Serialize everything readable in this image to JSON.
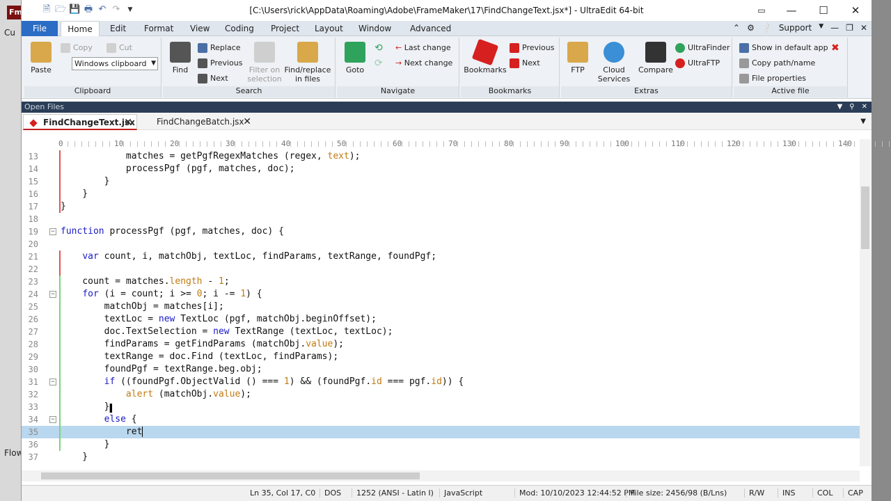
{
  "background": {
    "app_badge": "Fm",
    "left_text": "Cu",
    "flow_text": "Flow"
  },
  "window": {
    "title": "[C:\\Users\\rick\\AppData\\Roaming\\Adobe\\FrameMaker\\17\\FindChangeText.jsx*] - UltraEdit 64-bit"
  },
  "menu": {
    "file": "File",
    "tabs": [
      "Home",
      "Edit",
      "Format",
      "View",
      "Coding",
      "Project",
      "Layout",
      "Window",
      "Advanced"
    ],
    "support": "Support"
  },
  "ribbon": {
    "clipboard": {
      "label": "Clipboard",
      "paste": "Paste",
      "copy": "Copy",
      "cut": "Cut",
      "clipboard_select": "Windows clipboard"
    },
    "search": {
      "label": "Search",
      "find": "Find",
      "replace": "Replace",
      "previous": "Previous",
      "next": "Next",
      "filter": "Filter on selection",
      "find_replace_files": "Find/replace in files"
    },
    "navigate": {
      "label": "Navigate",
      "goto": "Goto",
      "last_change": "Last change",
      "next_change": "Next change"
    },
    "bookmarks": {
      "label": "Bookmarks",
      "bookmarks": "Bookmarks",
      "previous": "Previous",
      "next": "Next"
    },
    "extras": {
      "label": "Extras",
      "ftp": "FTP",
      "cloud": "Cloud Services",
      "compare": "Compare",
      "ultrafinder": "UltraFinder",
      "ultraftp": "UltraFTP"
    },
    "active_file": {
      "label": "Active file",
      "show_default": "Show in default app",
      "copy_path": "Copy path/name",
      "file_properties": "File properties"
    }
  },
  "open_files": {
    "title": "Open Files",
    "tabs": [
      "FindChangeText.jsx",
      "FindChangeBatch.jsx"
    ]
  },
  "ruler": [
    "0",
    "10",
    "20",
    "30",
    "40",
    "50",
    "60",
    "70",
    "80",
    "90",
    "100",
    "110",
    "120",
    "130",
    "140"
  ],
  "code_lines": [
    {
      "n": "13",
      "t": "            matches = getPgfRegexMatches (regex, text);"
    },
    {
      "n": "14",
      "t": "            processPgf (pgf, matches, doc);"
    },
    {
      "n": "15",
      "t": "        }"
    },
    {
      "n": "16",
      "t": "    }"
    },
    {
      "n": "17",
      "t": "}"
    },
    {
      "n": "18",
      "t": ""
    },
    {
      "n": "19",
      "t": "function processPgf (pgf, matches, doc) {"
    },
    {
      "n": "20",
      "t": ""
    },
    {
      "n": "21",
      "t": "    var count, i, matchObj, textLoc, findParams, textRange, foundPgf;"
    },
    {
      "n": "22",
      "t": ""
    },
    {
      "n": "23",
      "t": "    count = matches.length - 1;"
    },
    {
      "n": "24",
      "t": "    for (i = count; i >= 0; i -= 1) {"
    },
    {
      "n": "25",
      "t": "        matchObj = matches[i];"
    },
    {
      "n": "26",
      "t": "        textLoc = new TextLoc (pgf, matchObj.beginOffset);"
    },
    {
      "n": "27",
      "t": "        doc.TextSelection = new TextRange (textLoc, textLoc);"
    },
    {
      "n": "28",
      "t": "        findParams = getFindParams (matchObj.value);"
    },
    {
      "n": "29",
      "t": "        textRange = doc.Find (textLoc, findParams);"
    },
    {
      "n": "30",
      "t": "        foundPgf = textRange.beg.obj;"
    },
    {
      "n": "31",
      "t": "        if ((foundPgf.ObjectValid () === 1) && (foundPgf.id === pgf.id)) {"
    },
    {
      "n": "32",
      "t": "            alert (matchObj.value);"
    },
    {
      "n": "33",
      "t": "        }"
    },
    {
      "n": "34",
      "t": "        else {"
    },
    {
      "n": "35",
      "t": "            ret"
    },
    {
      "n": "36",
      "t": "        }"
    },
    {
      "n": "37",
      "t": "    }"
    }
  ],
  "status": {
    "position": "Ln 35, Col 17, C0",
    "line_ending": "DOS",
    "encoding": "1252  (ANSI - Latin I)",
    "language": "JavaScript",
    "modified": "Mod: 10/10/2023 12:44:52 PM",
    "file_size": "File size: 2456/98 (B/Lns)",
    "rw": "R/W",
    "ins": "INS",
    "col": "COL",
    "cap": "CAP"
  }
}
